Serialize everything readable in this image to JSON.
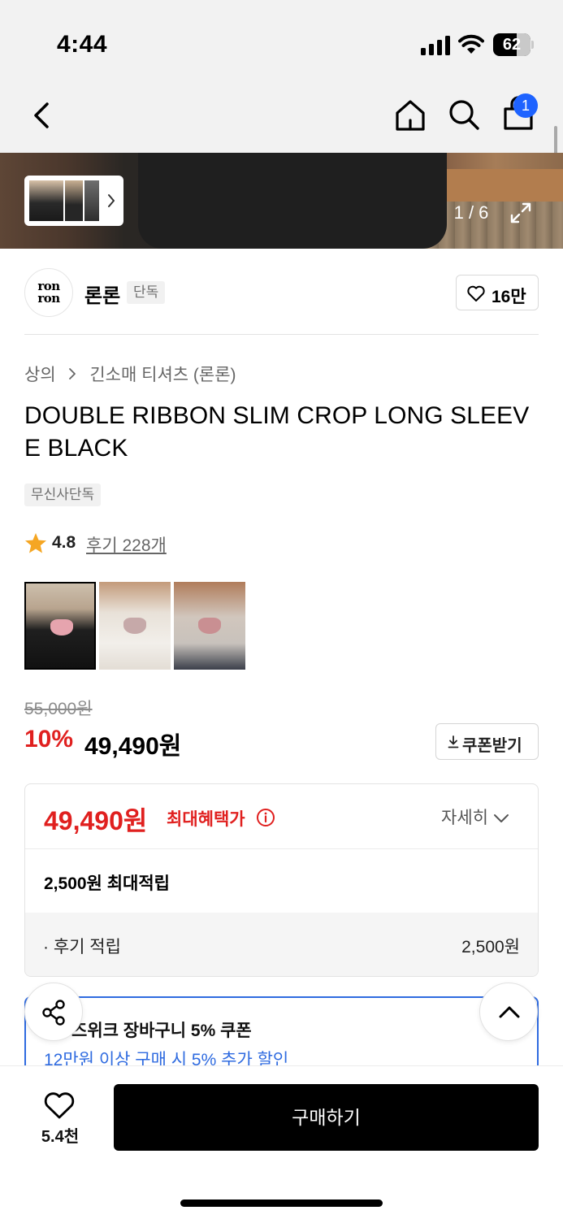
{
  "status_bar": {
    "time": "4:44",
    "battery": "62",
    "battery_level": 0.62
  },
  "header": {
    "cart_badge": "1"
  },
  "gallery": {
    "counter": "1 / 6",
    "current": 1,
    "total": 6
  },
  "brand": {
    "logo_line1": "ron",
    "logo_line2": "ron",
    "name": "론론",
    "exclusive_badge": "단독",
    "like_count": "16만"
  },
  "breadcrumb": {
    "category": "상의",
    "subcategory": "긴소매 티셔츠 (론론)"
  },
  "product": {
    "title": "DOUBLE RIBBON SLIM CROP LONG SLEEVE BLACK",
    "exclusive_tag": "무신사단독",
    "rating": "4.8",
    "rating_stars": 1,
    "review_link": "후기 228개",
    "colors": [
      "black",
      "white",
      "grey"
    ]
  },
  "price": {
    "original": "55,000원",
    "discount": "10%",
    "sale": "49,490원",
    "coupon_button": "쿠폰받기"
  },
  "benefit": {
    "max_price": "49,490원",
    "max_label": "최대혜택가",
    "detail_toggle": "자세히",
    "max_earn": "2,500원 최대적립",
    "review_earn_label": "· 후기 적립",
    "review_earn_value": "2,500원"
  },
  "promo": {
    "title": "즈위크 장바구니 5% 쿠폰",
    "subtitle": "12만원 이상 구매 시 5% 추가 할인"
  },
  "bottom_bar": {
    "wish_count": "5.4천",
    "buy_label": "구매하기"
  },
  "colors": {
    "accent_red": "#e0201f",
    "accent_blue": "#2f6be0",
    "badge_blue": "#1e63ff",
    "star": "#f5a623",
    "buy_button": "#000000"
  },
  "icons": [
    "back-icon",
    "home-icon",
    "search-icon",
    "cart-icon",
    "expand-icon",
    "heart-icon",
    "star-icon",
    "download-icon",
    "info-icon",
    "chevron-down-icon",
    "share-icon",
    "chevron-up-icon"
  ]
}
